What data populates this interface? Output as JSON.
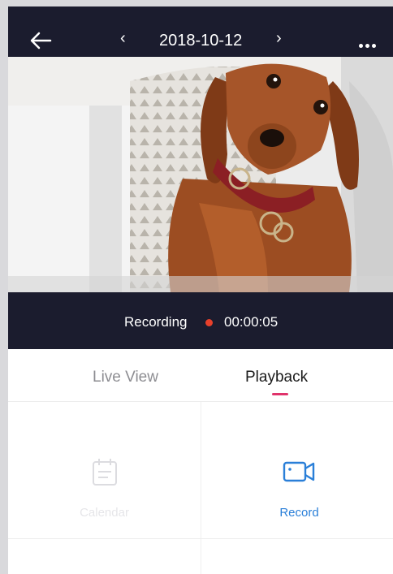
{
  "header": {
    "date": "2018-10-12",
    "icons": {
      "back": "arrow-left-icon",
      "prev": "chevron-left-icon",
      "next": "chevron-right-icon",
      "more": "ellipsis-icon"
    }
  },
  "recording": {
    "label": "Recording",
    "time": "00:00:05",
    "dot_color": "#e8402b"
  },
  "tabs": [
    {
      "label": "Live View",
      "active": false
    },
    {
      "label": "Playback",
      "active": true
    }
  ],
  "actions": [
    {
      "label": "Calendar",
      "icon": "calendar-icon",
      "enabled": false
    },
    {
      "label": "Record",
      "icon": "video-camera-icon",
      "enabled": true
    }
  ],
  "colors": {
    "header_bg": "#1b1c2e",
    "accent_pink": "#e0336b",
    "accent_blue": "#2a7fd8"
  }
}
